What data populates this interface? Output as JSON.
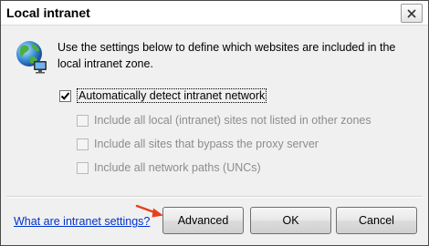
{
  "window": {
    "title": "Local intranet",
    "close_glyph": "✕"
  },
  "intro_text": "Use the settings below to define which websites are included in the local intranet zone.",
  "options": {
    "auto_detect": {
      "label": "Automatically detect intranet network",
      "checked": true,
      "enabled": true
    },
    "local_sites": {
      "label": "Include all local (intranet) sites not listed in other zones",
      "checked": false,
      "enabled": false
    },
    "bypass_proxy": {
      "label": "Include all sites that bypass the proxy server",
      "checked": false,
      "enabled": false
    },
    "network_paths": {
      "label": "Include all network paths (UNCs)",
      "checked": false,
      "enabled": false
    }
  },
  "help_link": "What are intranet settings?",
  "buttons": {
    "advanced": "Advanced",
    "ok": "OK",
    "cancel": "Cancel"
  },
  "icons": {
    "globe": "globe-network-icon",
    "close": "close-icon",
    "arrow": "red-arrow-icon"
  },
  "colors": {
    "link": "#0033cc",
    "arrow": "#e8401c"
  }
}
